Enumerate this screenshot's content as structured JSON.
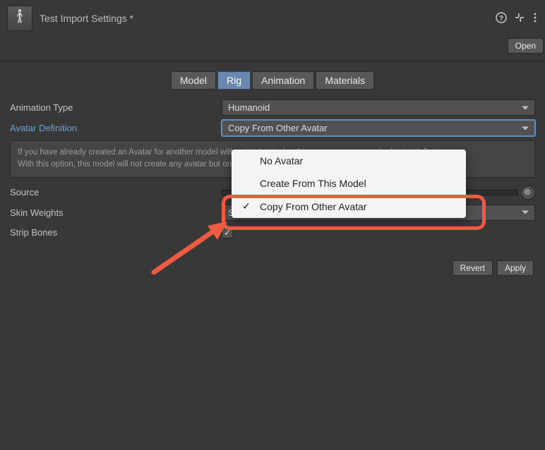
{
  "header": {
    "title": "Test Import Settings *",
    "open_label": "Open"
  },
  "tabs": [
    "Model",
    "Rig",
    "Animation",
    "Materials"
  ],
  "active_tab": "Rig",
  "fields": {
    "animation_type": {
      "label": "Animation Type",
      "value": "Humanoid"
    },
    "avatar_definition": {
      "label": "Avatar Definition",
      "value": "Copy From Other Avatar"
    },
    "help": {
      "line1": "If you have already created an Avatar for another model with a rig identical to this one, you can copy its Avatar definition.",
      "line2": "With this option, this model will not create any avatar but only import animations."
    },
    "source": {
      "label": "Source",
      "value": ""
    },
    "skin_weights": {
      "label": "Skin Weights",
      "value": "Standard (4 Bones)"
    },
    "strip_bones": {
      "label": "Strip Bones",
      "checked": true
    }
  },
  "buttons": {
    "revert": "Revert",
    "apply": "Apply"
  },
  "popup": {
    "items": [
      {
        "label": "No Avatar",
        "checked": false
      },
      {
        "label": "Create From This Model",
        "checked": false
      },
      {
        "label": "Copy From Other Avatar",
        "checked": true
      }
    ]
  }
}
